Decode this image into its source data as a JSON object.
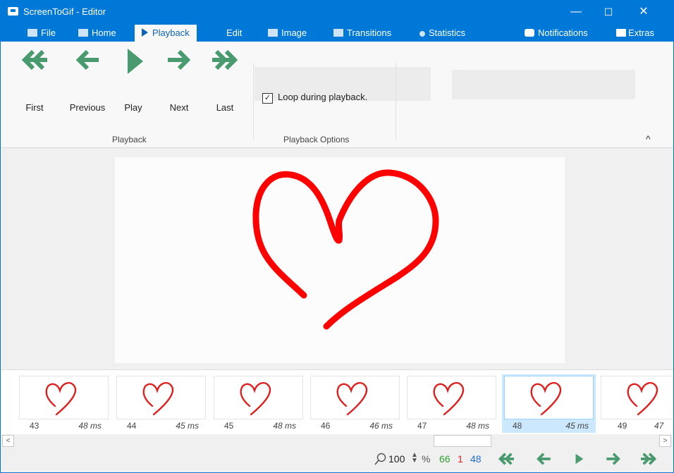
{
  "window": {
    "title": "ScreenToGif - Editor",
    "controls": {
      "minimize": "—",
      "maximize": "☐",
      "close": "✕"
    }
  },
  "tabs": [
    {
      "label": "File",
      "icon": "save-icon"
    },
    {
      "label": "Home",
      "icon": "home-icon"
    },
    {
      "label": "Playback",
      "icon": "play-icon",
      "active": true
    },
    {
      "label": "Edit",
      "icon": "pencil-icon"
    },
    {
      "label": "Image",
      "icon": "image-icon"
    },
    {
      "label": "Transitions",
      "icon": "transitions-icon"
    },
    {
      "label": "Statistics",
      "icon": "info-icon"
    }
  ],
  "tab_right": {
    "notifications": "Notifications",
    "extras": "Extras"
  },
  "ribbon": {
    "playback": {
      "first": "First",
      "previous": "Previous",
      "play": "Play",
      "next": "Next",
      "last": "Last",
      "group_label": "Playback"
    },
    "options": {
      "loop_label": "Loop during playback.",
      "loop_checked": true,
      "group_label": "Playback Options"
    },
    "collapse_icon": "^"
  },
  "frames": [
    {
      "number": "43",
      "delay": "48 ms"
    },
    {
      "number": "44",
      "delay": "45 ms"
    },
    {
      "number": "45",
      "delay": "48 ms"
    },
    {
      "number": "46",
      "delay": "46 ms"
    },
    {
      "number": "47",
      "delay": "48 ms"
    },
    {
      "number": "48",
      "delay": "45 ms",
      "selected": true
    },
    {
      "number": "49",
      "delay": "47"
    }
  ],
  "statusbar": {
    "zoom": "100",
    "zoom_unit": "%",
    "frame_count": "66",
    "selected_count": "1",
    "current_frame": "48"
  },
  "colors": {
    "accent": "#0078d7",
    "nav_arrow": "#4a9a70",
    "stroke": "#ff0000",
    "count_green": "#2e9e2e",
    "count_red": "#d81e1e",
    "count_blue": "#1f6fcf"
  }
}
